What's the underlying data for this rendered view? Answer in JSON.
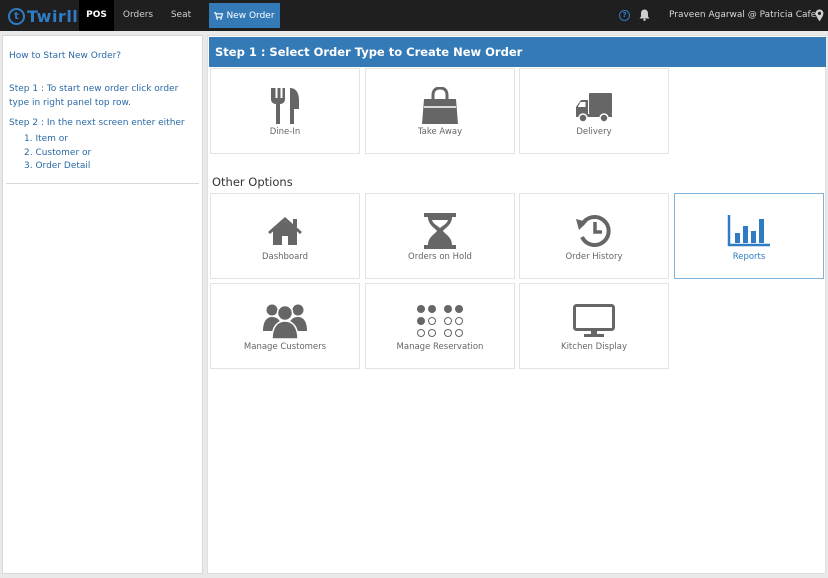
{
  "topbar": {
    "logo_text": "Twirll",
    "nav": [
      "POS",
      "Orders",
      "Seat"
    ],
    "new_order_label": "New Order",
    "user_label": "Praveen Agarwal @ Patricia Cafe"
  },
  "help": {
    "title": "How to Start New Order?",
    "step1": "Step 1 : To start new order click order type in right panel top row.",
    "step2": "Step 2 : In the next screen enter either",
    "options": [
      "1. Item or",
      "2. Customer or",
      "3. Order Detail"
    ]
  },
  "main": {
    "step_header": "Step 1 : Select Order Type to Create New Order",
    "order_types": [
      {
        "label": "Dine-In",
        "icon": "fork-knife-icon"
      },
      {
        "label": "Take Away",
        "icon": "shopping-bag-icon"
      },
      {
        "label": "Delivery",
        "icon": "truck-icon"
      }
    ],
    "other_options_title": "Other Options",
    "other_options": [
      {
        "label": "Dashboard",
        "icon": "home-icon"
      },
      {
        "label": "Orders on Hold",
        "icon": "hourglass-icon"
      },
      {
        "label": "Order History",
        "icon": "history-icon"
      },
      {
        "label": "Reports",
        "icon": "bar-chart-icon",
        "active": true
      },
      {
        "label": "Manage Customers",
        "icon": "users-icon"
      },
      {
        "label": "Manage Reservation",
        "icon": "reservation-icon"
      },
      {
        "label": "Kitchen Display",
        "icon": "monitor-icon"
      }
    ]
  },
  "colors": {
    "accent": "#337ab7",
    "topbar": "#1f1f1f",
    "icon_gray": "#666666",
    "icon_active": "#2f7bc4"
  }
}
